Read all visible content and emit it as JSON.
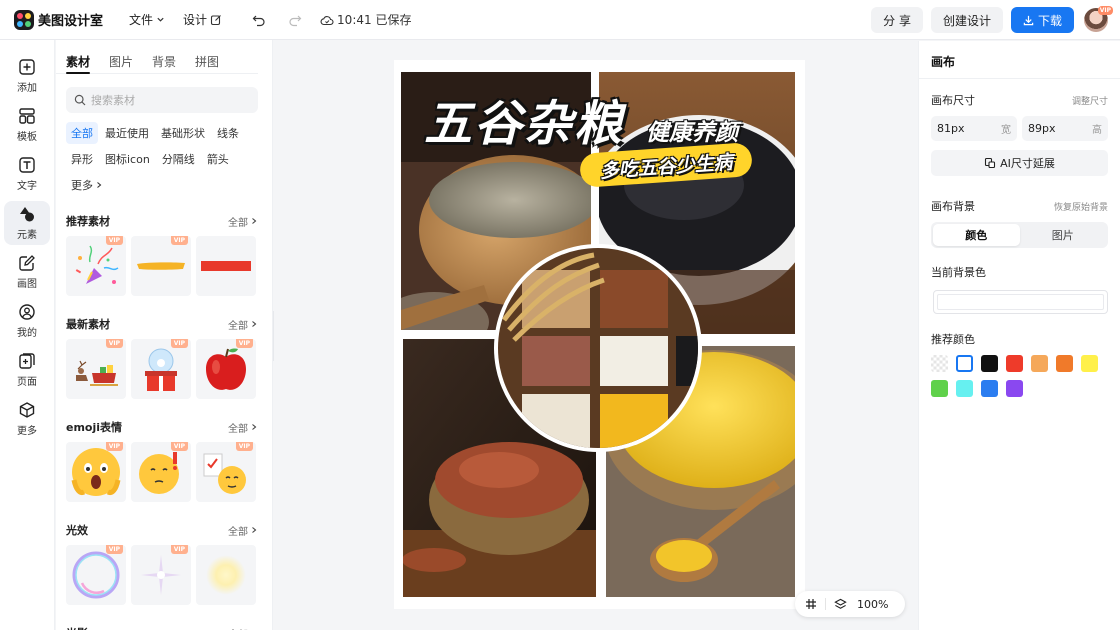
{
  "app": {
    "title": "美图设计室"
  },
  "topbar": {
    "file_menu": "文件",
    "design_menu": "设计",
    "save_status": "10:41 已保存",
    "share_label": "分 享",
    "create_label": "创建设计",
    "download_label": "下载",
    "avatar_badge": "VIP"
  },
  "rail": {
    "items": [
      {
        "label": "添加",
        "icon": "plus-square-icon"
      },
      {
        "label": "模板",
        "icon": "layout-icon"
      },
      {
        "label": "文字",
        "icon": "text-icon"
      },
      {
        "label": "元素",
        "icon": "shapes-icon",
        "active": true
      },
      {
        "label": "画图",
        "icon": "pen-edit-icon"
      },
      {
        "label": "我的",
        "icon": "user-icon"
      },
      {
        "label": "页面",
        "icon": "page-add-icon"
      },
      {
        "label": "更多",
        "icon": "cube-icon"
      }
    ]
  },
  "materials": {
    "tabs": [
      "素材",
      "图片",
      "背景",
      "拼图"
    ],
    "active_tab": 0,
    "search_placeholder": "搜索素材",
    "chips": [
      "全部",
      "最近使用",
      "基础形状",
      "线条",
      "异形",
      "图标icon",
      "分隔线",
      "箭头",
      "更多"
    ],
    "active_chip": 0,
    "vip_badge": "VIP",
    "more_label": "全部",
    "sections": [
      {
        "title": "推荐素材",
        "items": [
          "party-popper",
          "yellow-brush-stroke",
          "red-bar"
        ]
      },
      {
        "title": "最新素材",
        "items": [
          "reindeer-sleigh",
          "snowglobe-gift",
          "red-apple"
        ]
      },
      {
        "title": "emoji表情",
        "items": [
          "shocked-emoji",
          "thinking-emoji",
          "checklist-emoji"
        ]
      },
      {
        "title": "光效",
        "items": [
          "bubble-glow",
          "star-sparkle",
          "soft-light"
        ]
      },
      {
        "title": "光影",
        "items": []
      }
    ]
  },
  "canvas": {
    "poster_title": "五谷杂粮",
    "poster_subtitle": "健康养颜",
    "poster_banner": "多吃五谷少生病",
    "zoom": "100%"
  },
  "right_panel": {
    "title": "画布",
    "size_label": "画布尺寸",
    "size_link": "调整尺寸",
    "width_value": "81px",
    "width_unit": "宽",
    "height_value": "89px",
    "height_unit": "高",
    "ai_button": "AI尺寸延展",
    "bg_label": "画布背景",
    "bg_restore": "恢复原始背景",
    "seg_color": "颜色",
    "seg_image": "图片",
    "current_bg_label": "当前背景色",
    "recommend_label": "推荐颜色",
    "swatches": [
      "transparent",
      "#ffffff",
      "#111111",
      "#ee3b2a",
      "#f5a85a",
      "#f07a2a",
      "#fff04a",
      "#5fd14a",
      "#66f0f0",
      "#2b7df0",
      "#8a48f0"
    ]
  }
}
